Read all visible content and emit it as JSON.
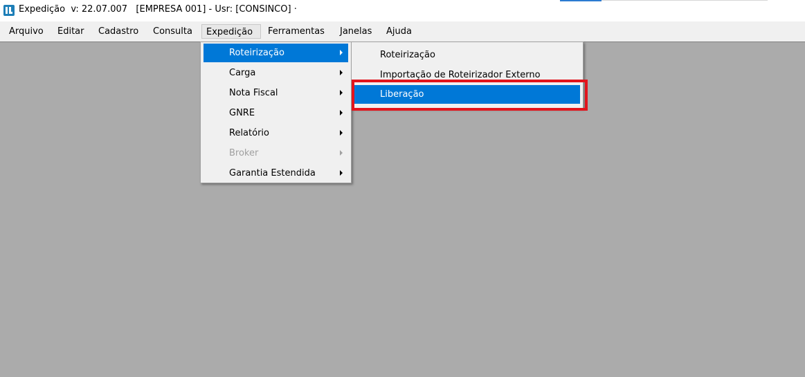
{
  "window": {
    "title": "Expedição  v: 22.07.007   [EMPRESA 001] - Usr: [CONSINCO] ·"
  },
  "menubar": {
    "items": [
      {
        "label": "Arquivo"
      },
      {
        "label": "Editar"
      },
      {
        "label": "Cadastro"
      },
      {
        "label": "Consulta"
      },
      {
        "label": "Expedição",
        "open": true
      },
      {
        "label": "Ferramentas"
      },
      {
        "label": "Janelas"
      },
      {
        "label": "Ajuda"
      }
    ]
  },
  "expedicao_menu": {
    "items": [
      {
        "label": "Roteirização",
        "has_submenu": true,
        "highlighted": true
      },
      {
        "label": "Carga",
        "has_submenu": true
      },
      {
        "label": "Nota Fiscal",
        "has_submenu": true
      },
      {
        "label": "GNRE",
        "has_submenu": true
      },
      {
        "label": "Relatório",
        "has_submenu": true
      },
      {
        "label": "Broker",
        "has_submenu": true,
        "disabled": true
      },
      {
        "label": "Garantia Estendida",
        "has_submenu": true
      }
    ]
  },
  "roteirizacao_submenu": {
    "items": [
      {
        "label": "Roteirização"
      },
      {
        "label": "Importação de Roteirizador Externo"
      },
      {
        "label": "Liberação",
        "highlighted": true
      }
    ]
  },
  "colors": {
    "highlight": "#0078d7",
    "annotation_box": "#e2141c",
    "workspace": "#ababab",
    "menu_bg": "#f0f0f0"
  },
  "icons": {
    "app": "app-logo-icon",
    "submenu_arrow": "chevron-right-icon"
  }
}
